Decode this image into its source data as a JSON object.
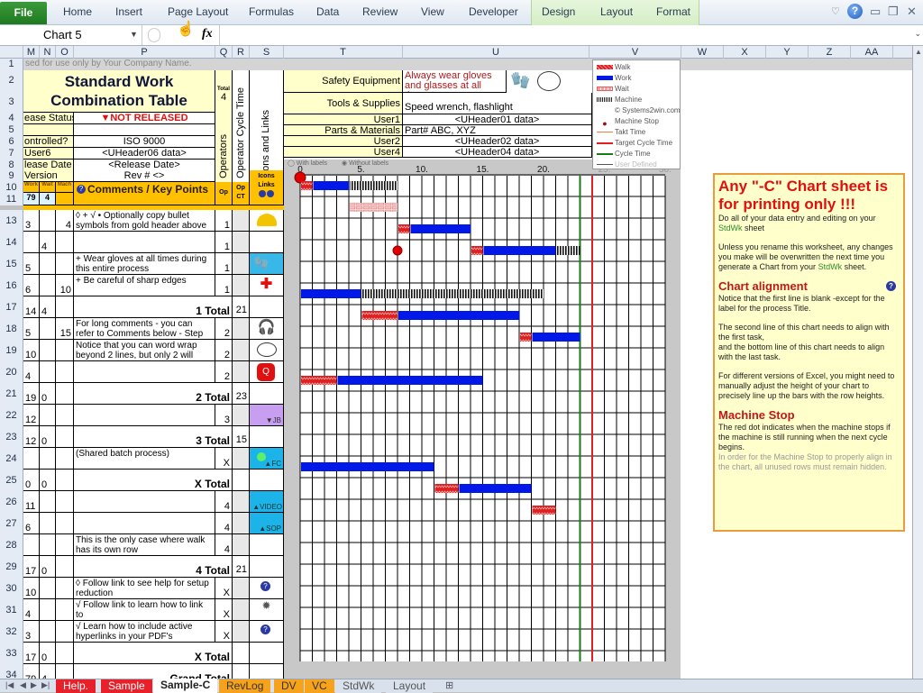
{
  "ribbon": {
    "file": "File",
    "tabs": [
      "Home",
      "Insert",
      "Page Layout",
      "Formulas",
      "Data",
      "Review",
      "View",
      "Developer"
    ],
    "context_tabs": [
      "Design",
      "Layout",
      "Format"
    ]
  },
  "formula_bar": {
    "name_box": "Chart 5",
    "fx_label": "fx",
    "formula": ""
  },
  "columns": [
    "M",
    "N",
    "O",
    "P",
    "Q",
    "R",
    "S",
    "T",
    "U",
    "V",
    "W",
    "X",
    "Y",
    "Z",
    "AA"
  ],
  "rows": [
    "1",
    "2",
    "3",
    "4",
    "5",
    "6",
    "7",
    "8",
    "9",
    "10",
    "11",
    "13",
    "14",
    "15",
    "16",
    "17",
    "18",
    "19",
    "20",
    "21",
    "22",
    "23",
    "24",
    "25",
    "26",
    "27",
    "28",
    "29",
    "30",
    "31",
    "32",
    "33",
    "34"
  ],
  "header": {
    "row1_notice": "sed for use only by Your Company Name.",
    "title_line1": "Standard Work",
    "title_line2": "Combination Table",
    "total_label": "Total",
    "total_operators": "4",
    "operators_label": "Operators",
    "op_cycle_label": "Operator Cycle Time",
    "icons_links_label": "Icons and Links",
    "fields": [
      {
        "label": "ease Status",
        "value": "▼NOT RELEASED"
      },
      {
        "label": "",
        "value": ""
      },
      {
        "label": "ontrolled?",
        "value": "ISO 9000"
      },
      {
        "label": "User6",
        "value": "<UHeader06 data>"
      },
      {
        "label": "lease Date",
        "value": "<Release Date>"
      },
      {
        "label": "Version",
        "value": "Rev # <>"
      }
    ],
    "right_fields": [
      {
        "label": "Safety Equipment",
        "value": "Always wear gloves and glasses at all times"
      },
      {
        "label": "Tools & Supplies",
        "value": "Speed wrench, flashlight"
      },
      {
        "label": "User1",
        "value": "<UHeader01 data>"
      },
      {
        "label": "Parts & Materials",
        "value": "Part# ABC, XYZ"
      },
      {
        "label": "User2",
        "value": "<UHeader02 data>"
      },
      {
        "label": "User4",
        "value": "<UHeader04 data>"
      }
    ],
    "col_work": "Work",
    "col_wait": "Wait",
    "col_mach": "Mach",
    "comments_header": "Comments / Key Points",
    "op_header": "Op",
    "opct_header_1": "Op",
    "opct_header_2": "CT",
    "icons_header_1": "Icons",
    "icons_header_2": "Links",
    "sum_work": "79",
    "sum_wait": "4",
    "chart_options": [
      "With labels",
      "Without labels"
    ]
  },
  "table_rows": [
    {
      "row": "13",
      "work": "3",
      "wait": "",
      "mach": "4",
      "comment": "◊ + √ • Optionally copy bullet\nsymbols from gold header above",
      "op": "1",
      "opct": "",
      "icon": "hard-hat"
    },
    {
      "row": "14",
      "work": "",
      "wait": "4",
      "mach": "",
      "comment": "",
      "op": "1",
      "opct": "",
      "icon": ""
    },
    {
      "row": "15",
      "work": "5",
      "wait": "",
      "mach": "",
      "comment": "+ Wear gloves at all times during\nthis entire process",
      "op": "1",
      "opct": "",
      "icon": "gloves"
    },
    {
      "row": "16",
      "work": "6",
      "wait": "",
      "mach": "10",
      "comment": "+ Be careful of sharp edges",
      "op": "1",
      "opct": "",
      "icon": "red-cross"
    },
    {
      "row": "17",
      "work": "14",
      "wait": "4",
      "mach": "",
      "comment": "1 Total",
      "op": "",
      "opct": "21",
      "icon": "",
      "total": true
    },
    {
      "row": "18",
      "work": "5",
      "wait": "",
      "mach": "15",
      "comment": "For long comments - you can\nrefer to Comments below - Step",
      "op": "2",
      "opct": "",
      "icon": "ear-muffs"
    },
    {
      "row": "19",
      "work": "10",
      "wait": "",
      "mach": "",
      "comment": "Notice that you can word wrap\nbeyond 2 lines, but only 2 will",
      "op": "2",
      "opct": "",
      "icon": "safety-glasses"
    },
    {
      "row": "20",
      "work": "4",
      "wait": "",
      "mach": "",
      "comment": "",
      "op": "2",
      "opct": "",
      "icon": "quality-stop"
    },
    {
      "row": "21",
      "work": "19",
      "wait": "0",
      "mach": "",
      "comment": "2 Total",
      "op": "",
      "opct": "23",
      "icon": "",
      "total": true
    },
    {
      "row": "22",
      "work": "12",
      "wait": "",
      "mach": "",
      "comment": "",
      "op": "3",
      "opct": "",
      "icon": "jb-link"
    },
    {
      "row": "23",
      "work": "12",
      "wait": "0",
      "mach": "",
      "comment": "3 Total",
      "op": "",
      "opct": "15",
      "icon": "",
      "total": true
    },
    {
      "row": "24",
      "work": "",
      "wait": "",
      "mach": "",
      "comment": "(Shared batch process)",
      "op": "X",
      "opct": "",
      "icon": "fc-link"
    },
    {
      "row": "25",
      "work": "0",
      "wait": "0",
      "mach": "",
      "comment": "X Total",
      "op": "",
      "opct": "",
      "icon": "",
      "total": true
    },
    {
      "row": "26",
      "work": "11",
      "wait": "",
      "mach": "",
      "comment": "",
      "op": "4",
      "opct": "",
      "icon": "video-link"
    },
    {
      "row": "27",
      "work": "6",
      "wait": "",
      "mach": "",
      "comment": "",
      "op": "4",
      "opct": "",
      "icon": "sop-link"
    },
    {
      "row": "28",
      "work": "",
      "wait": "",
      "mach": "",
      "comment": "This is the only case where walk\nhas its own row",
      "op": "4",
      "opct": "",
      "icon": ""
    },
    {
      "row": "29",
      "work": "17",
      "wait": "0",
      "mach": "",
      "comment": "4 Total",
      "op": "",
      "opct": "21",
      "icon": "",
      "total": true
    },
    {
      "row": "30",
      "work": "10",
      "wait": "",
      "mach": "",
      "comment": "◊ Follow link to see help for setup\nreduction",
      "op": "X",
      "opct": "",
      "icon": "help"
    },
    {
      "row": "31",
      "work": "4",
      "wait": "",
      "mach": "",
      "comment": "√ Follow link to learn how to link to\nrelated documents",
      "op": "X",
      "opct": "",
      "icon": "gear"
    },
    {
      "row": "32",
      "work": "3",
      "wait": "",
      "mach": "",
      "comment": "√ Learn how to include active\nhyperlinks in your PDF's",
      "op": "X",
      "opct": "",
      "icon": "help"
    },
    {
      "row": "33",
      "work": "17",
      "wait": "0",
      "mach": "",
      "comment": "X Total",
      "op": "",
      "opct": "",
      "icon": "",
      "total": true
    },
    {
      "row": "34",
      "work": "79",
      "wait": "4",
      "mach": "",
      "comment": "Grand Total",
      "op": "",
      "opct": "",
      "icon": "",
      "total": true
    }
  ],
  "legend": {
    "items": [
      {
        "label": "Walk",
        "kind": "walk"
      },
      {
        "label": "Work",
        "kind": "work"
      },
      {
        "label": "Wait",
        "kind": "wait"
      },
      {
        "label": "Machine",
        "kind": "machine"
      },
      {
        "label": "© Systems2win.com",
        "kind": "text"
      },
      {
        "label": "Machine Stop",
        "kind": "dot"
      },
      {
        "label": "Takt Time",
        "kind": "takt"
      },
      {
        "label": "Target Cycle Time",
        "kind": "target"
      },
      {
        "label": "Cycle Time",
        "kind": "cycle"
      },
      {
        "label": "User Defined",
        "kind": "user"
      }
    ]
  },
  "chart_data": {
    "type": "bar",
    "subtype": "gantt",
    "title": "",
    "x_ticks": [
      "0",
      "5.",
      "10.",
      "15.",
      "20.",
      "25.",
      "30."
    ],
    "xlim": [
      0,
      30
    ],
    "grid": true,
    "cycle_time": 23,
    "target_cycle_time": 24,
    "rows": [
      {
        "row": "13",
        "segments": [
          {
            "kind": "walk",
            "start": 0,
            "end": 1
          },
          {
            "kind": "work",
            "start": 1,
            "end": 4
          },
          {
            "kind": "machine",
            "start": 4,
            "end": 8
          }
        ]
      },
      {
        "row": "14",
        "segments": [
          {
            "kind": "wait",
            "start": 4,
            "end": 8
          }
        ]
      },
      {
        "row": "15",
        "segments": [
          {
            "kind": "walk",
            "start": 8,
            "end": 9
          },
          {
            "kind": "work",
            "start": 9,
            "end": 14
          }
        ]
      },
      {
        "row": "16",
        "segments": [
          {
            "kind": "walk",
            "start": 14,
            "end": 15
          },
          {
            "kind": "work",
            "start": 15,
            "end": 21
          },
          {
            "kind": "machine",
            "start": 21,
            "end": 23
          }
        ],
        "machine_stop": 8
      },
      {
        "row": "17",
        "segments": []
      },
      {
        "row": "18",
        "segments": [
          {
            "kind": "work",
            "start": 0,
            "end": 5
          },
          {
            "kind": "machine",
            "start": 5,
            "end": 20
          }
        ]
      },
      {
        "row": "19",
        "segments": [
          {
            "kind": "walk",
            "start": 5,
            "end": 8
          },
          {
            "kind": "work",
            "start": 8,
            "end": 18
          }
        ]
      },
      {
        "row": "20",
        "segments": [
          {
            "kind": "walk",
            "start": 18,
            "end": 19
          },
          {
            "kind": "work",
            "start": 19,
            "end": 23
          }
        ]
      },
      {
        "row": "21",
        "segments": []
      },
      {
        "row": "22",
        "segments": [
          {
            "kind": "walk",
            "start": 0,
            "end": 3
          },
          {
            "kind": "work",
            "start": 3,
            "end": 15
          }
        ]
      },
      {
        "row": "23",
        "segments": []
      },
      {
        "row": "24",
        "segments": []
      },
      {
        "row": "25",
        "segments": []
      },
      {
        "row": "26",
        "segments": [
          {
            "kind": "work",
            "start": 0,
            "end": 11
          }
        ]
      },
      {
        "row": "27",
        "segments": [
          {
            "kind": "walk",
            "start": 11,
            "end": 13
          },
          {
            "kind": "work",
            "start": 13,
            "end": 19
          }
        ]
      },
      {
        "row": "28",
        "segments": [
          {
            "kind": "walk",
            "start": 19,
            "end": 21
          }
        ]
      },
      {
        "row": "29",
        "segments": []
      },
      {
        "row": "30",
        "segments": []
      },
      {
        "row": "31",
        "segments": []
      },
      {
        "row": "32",
        "segments": []
      },
      {
        "row": "33",
        "segments": []
      },
      {
        "row": "34",
        "segments": []
      }
    ],
    "start_dot": 0
  },
  "notes": {
    "title": "Any \"-C\" Chart sheet is for printing only !!!",
    "p1a": "Do all of your data entry and editing on your ",
    "p1link": "StdWk",
    "p1b": " sheet",
    "p2a": "Unless you rename this worksheet, any changes you make will be overwritten the next time you generate a Chart from your ",
    "p2link": "StdWk",
    "p2b": " sheet.",
    "h_align": "Chart alignment",
    "p3": "Notice that the first line is blank -except for the label for the process Title.",
    "p4": "The second line of this chart needs to align with the first task,\nand the bottom line of this chart needs to align with the last task.",
    "p5": "For different versions of Excel, you might need to manually adjust the height of your chart to precisely line up the bars with the row heights.",
    "h_stop": "Machine Stop",
    "p6": "The red dot indicates when the machine stops if the machine is still running when the next cycle begins.",
    "p7": "In order for the Machine Stop to properly align in the chart, all unused rows must remain hidden."
  },
  "sheet_tabs": [
    {
      "label": "Help.",
      "color": "#e8202a",
      "text": "#fff"
    },
    {
      "label": "Sample",
      "color": "#e8202a",
      "text": "#fff"
    },
    {
      "label": "Sample-C",
      "color": "#ffffff",
      "text": "#222",
      "active": true
    },
    {
      "label": "RevLog",
      "color": "#f7a21b",
      "text": "#333"
    },
    {
      "label": "DV",
      "color": "#f7a21b",
      "text": "#333"
    },
    {
      "label": "VC",
      "color": "#f7a21b",
      "text": "#333"
    },
    {
      "label": "StdWk",
      "color": "#d9e2ec",
      "text": "#555"
    },
    {
      "label": "Layout",
      "color": "#d9e2ec",
      "text": "#555"
    }
  ]
}
